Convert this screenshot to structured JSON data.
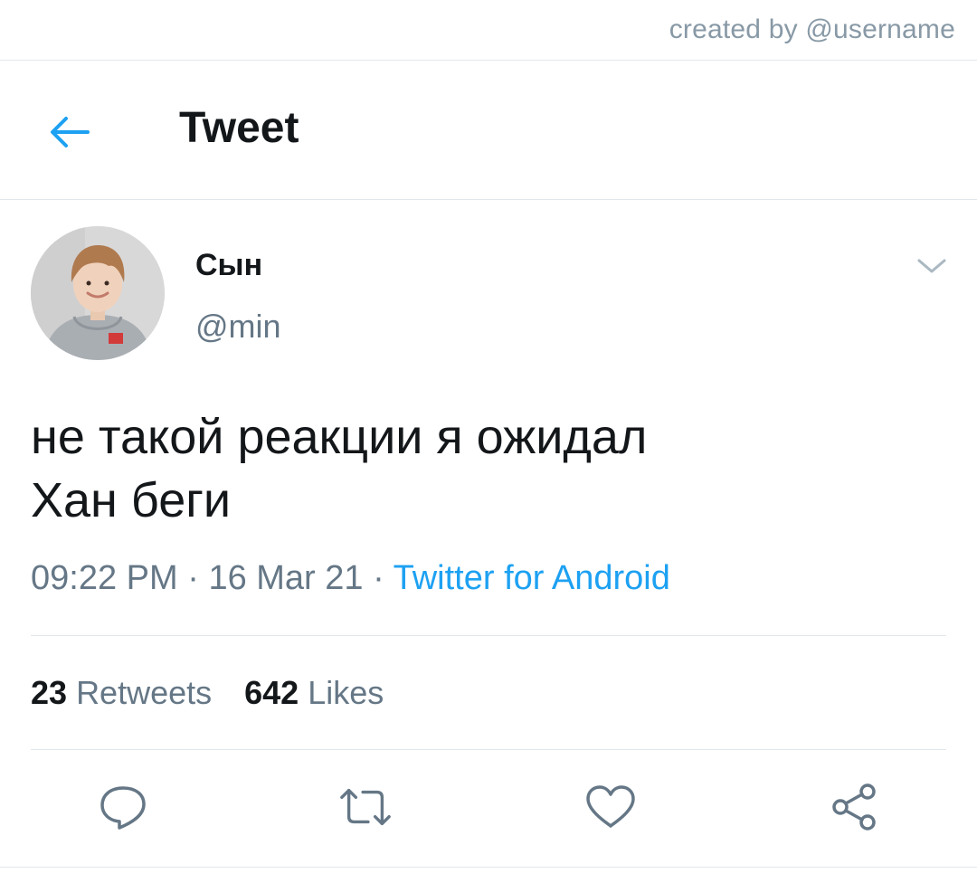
{
  "credit": "created by @username",
  "header": {
    "title": "Tweet",
    "back_icon": "arrow-left-icon"
  },
  "tweet": {
    "author": {
      "name": "Сын",
      "handle": "@min"
    },
    "text_lines": [
      "не такой реакции я ожидал",
      "Хан беги"
    ],
    "time": "09:22 PM",
    "date": "16 Mar 21",
    "separator": "·",
    "source": "Twitter for Android",
    "stats": {
      "retweets_count": "23",
      "retweets_label": "Retweets",
      "likes_count": "642",
      "likes_label": "Likes"
    }
  },
  "actions": [
    {
      "name": "reply",
      "icon": "reply-icon"
    },
    {
      "name": "retweet",
      "icon": "retweet-icon"
    },
    {
      "name": "like",
      "icon": "heart-icon"
    },
    {
      "name": "share",
      "icon": "share-icon"
    }
  ],
  "colors": {
    "accent": "#1da1f2",
    "text_primary": "#14171a",
    "text_secondary": "#657786",
    "divider": "#e1e8ed",
    "icon_gray": "#657786"
  }
}
